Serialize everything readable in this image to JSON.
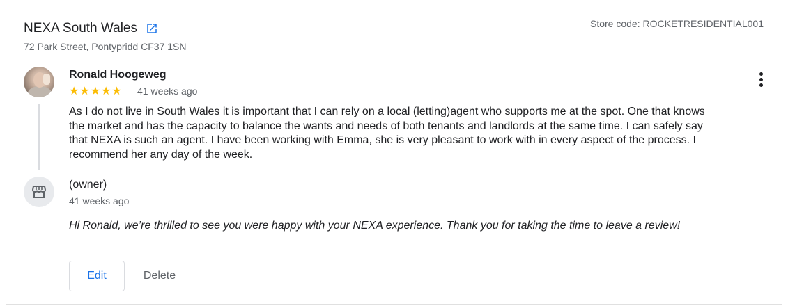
{
  "location": {
    "name": "NEXA South Wales",
    "address": "72 Park Street, Pontypridd CF37 1SN",
    "store_code": "Store code: ROCKETRESIDENTIAL001",
    "link_icon": "open-in-new-icon"
  },
  "review": {
    "reviewer": "Ronald Hoogeweg",
    "stars": "★★★★★",
    "rating": 5,
    "age": "41 weeks ago",
    "text": "As I do not live in South Wales it is important that I can rely on a local (letting)agent who supports me at the spot. One that knows the market and has the capacity to balance the wants and needs of both tenants and landlords at the same time. I can safely say that NEXA is such an agent. I have been working with Emma, she is very pleasant to work with in every aspect of the process. I recommend her any day of the week.",
    "menu_icon": "more-vert-icon"
  },
  "reply": {
    "author": "(owner)",
    "age": "41 weeks ago",
    "text": "Hi Ronald, we’re thrilled to see you were happy with your NEXA experience. Thank you for taking the time to leave a review!",
    "avatar_icon": "storefront-icon"
  },
  "actions": {
    "edit_label": "Edit",
    "delete_label": "Delete"
  },
  "colors": {
    "star": "#fbbc04",
    "link_blue": "#1a73e8",
    "muted_text": "#5f6368"
  }
}
